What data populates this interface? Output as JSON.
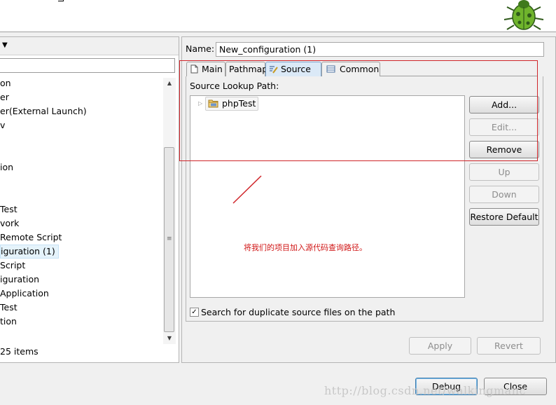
{
  "header": {
    "bug_icon": "debug-bug-icon"
  },
  "launch_config_tree": {
    "items": [
      "on",
      "er",
      "er(External Launch)",
      "v",
      "",
      "ion",
      "",
      "Test",
      "vork",
      "Remote Script",
      "iguration (1)",
      "Script",
      "iguration",
      "Application",
      "Test",
      "tion"
    ],
    "selected_index": 10,
    "item_count_label": "25 items",
    "filter_value": ""
  },
  "config": {
    "name_label": "Name:",
    "name_value": "New_configuration (1)"
  },
  "tabs": [
    {
      "label": "Main",
      "icon": "document-icon",
      "active": false
    },
    {
      "label": "Pathmap",
      "icon": "",
      "active": false
    },
    {
      "label": "Source",
      "icon": "source-lookup-icon",
      "active": true
    },
    {
      "label": "Common",
      "icon": "common-tab-icon",
      "active": false
    }
  ],
  "source_tab": {
    "lookup_path_label": "Source Lookup Path:",
    "entries": [
      {
        "label": "phpTest",
        "icon": "project-folder-icon"
      }
    ],
    "buttons": {
      "add": "Add...",
      "edit": "Edit...",
      "remove": "Remove",
      "up": "Up",
      "down": "Down",
      "restore": "Restore Default"
    },
    "duplicate_search_label": "Search for duplicate source files on the path",
    "duplicate_search_checked": true
  },
  "footer": {
    "apply": "Apply",
    "revert": "Revert",
    "debug": "Debug",
    "close": "Close"
  },
  "annotation": {
    "note": "将我们的项目加入源代码查询路径。",
    "color": "#d0252a"
  },
  "watermark": "http://blog.csdn.net/walkingmanc"
}
